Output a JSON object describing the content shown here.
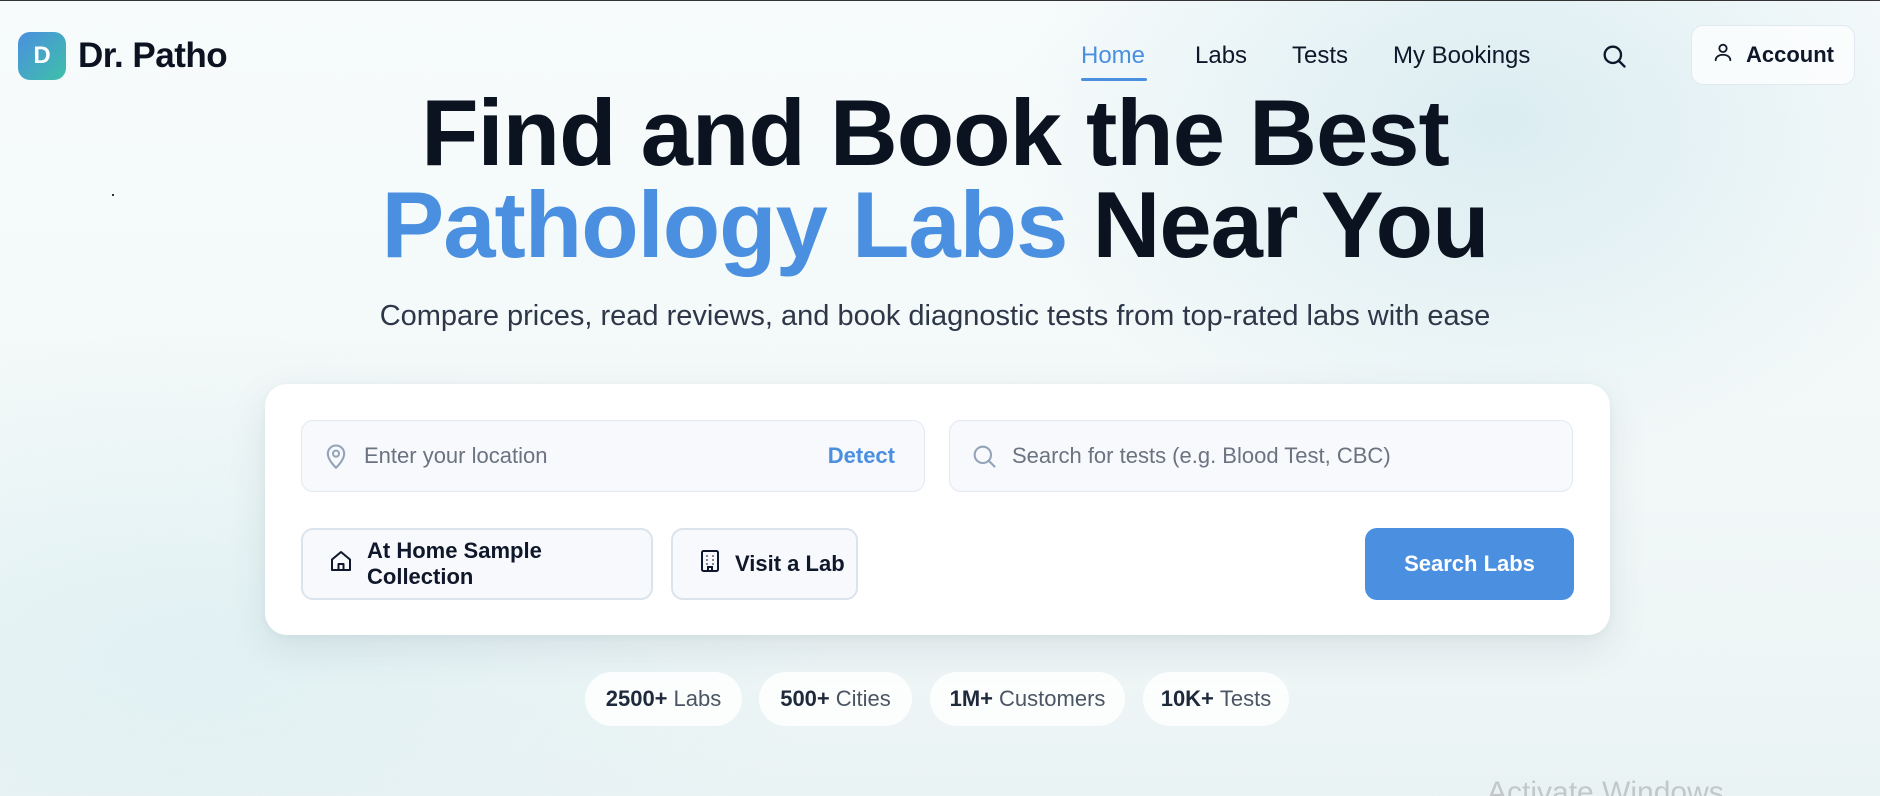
{
  "brand": {
    "logo_letter": "D",
    "name": "Dr. Patho",
    "accent": "#4a8fe0"
  },
  "nav": {
    "items": [
      {
        "label": "Home",
        "active": true
      },
      {
        "label": "Labs",
        "active": false
      },
      {
        "label": "Tests",
        "active": false
      },
      {
        "label": "My Bookings",
        "active": false
      }
    ],
    "search_icon": "search-icon",
    "account_label": "Account",
    "account_icon": "user-icon"
  },
  "hero": {
    "line1": "Find and Book the Best",
    "line2_accent": "Pathology Labs",
    "line2_rest": "Near You",
    "subtitle": "Compare prices, read reviews, and book diagnostic tests from top-rated labs with ease"
  },
  "search": {
    "location_placeholder": "Enter your location",
    "location_icon": "map-pin-icon",
    "detect_label": "Detect",
    "tests_placeholder": "Search for tests (e.g. Blood Test, CBC)",
    "tests_icon": "search-icon",
    "options": [
      {
        "label": "At Home Sample Collection",
        "icon": "home-icon"
      },
      {
        "label": "Visit a Lab",
        "icon": "building-icon"
      }
    ],
    "submit_label": "Search Labs"
  },
  "stats": [
    {
      "value": "2500+",
      "label": "Labs"
    },
    {
      "value": "500+",
      "label": "Cities"
    },
    {
      "value": "1M+",
      "label": "Customers"
    },
    {
      "value": "10K+",
      "label": "Tests"
    }
  ],
  "watermark": "Activate Windows"
}
